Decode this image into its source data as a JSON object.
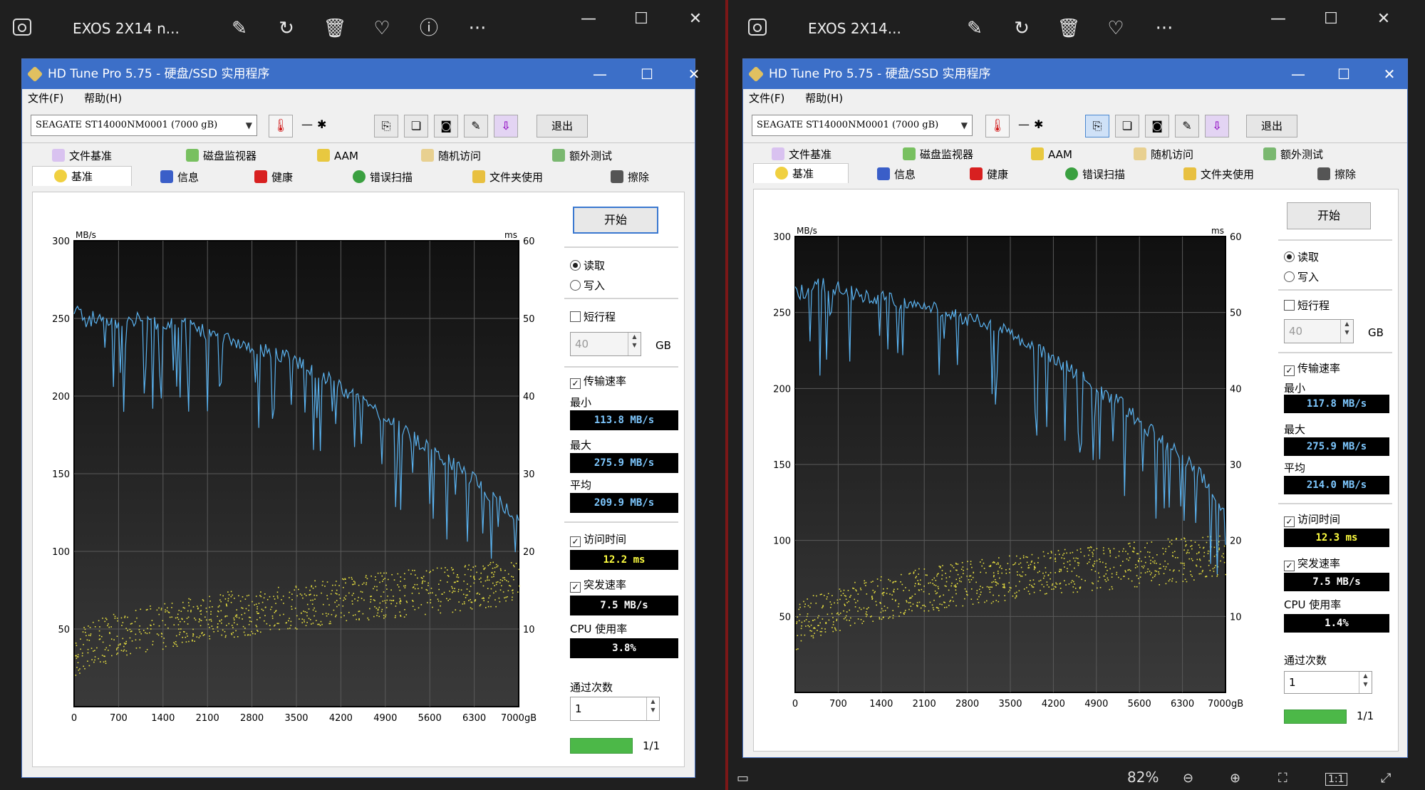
{
  "viewers": [
    {
      "title": "EXOS 2X14 n...",
      "toolbar_icons": [
        "edit-image-icon",
        "rotate-icon",
        "delete-icon",
        "favorite-icon",
        "info-icon",
        "more-icon"
      ],
      "app": {
        "title": "HD Tune Pro 5.75 - 硬盘/SSD 实用程序",
        "menu": [
          "文件(F)",
          "帮助(H)"
        ],
        "drive": "SEAGATE ST14000NM0001 (7000 gB)",
        "temp_dash": "—",
        "exit_label": "退出",
        "tabs_row1": [
          "文件基准",
          "磁盘监视器",
          "AAM",
          "随机访问",
          "额外测试"
        ],
        "tabs_row2": [
          "基准",
          "信息",
          "健康",
          "错误扫描",
          "文件夹使用",
          "擦除"
        ],
        "start_label": "开始",
        "read_label": "读取",
        "write_label": "写入",
        "short_stroke_label": "短行程",
        "short_stroke_value": "40",
        "gb_label": "GB",
        "transfer_rate_label": "传输速率",
        "min_label": "最小",
        "min_value": "113.8 MB/s",
        "max_label": "最大",
        "max_value": "275.9 MB/s",
        "avg_label": "平均",
        "avg_value": "209.9 MB/s",
        "access_time_label": "访问时间",
        "access_time_value": "12.2 ms",
        "burst_rate_label": "突发速率",
        "burst_rate_value": "7.5 MB/s",
        "cpu_label": "CPU 使用率",
        "cpu_value": "3.8%",
        "passes_label": "通过次数",
        "passes_value": "1",
        "progress_text": "1/1",
        "progress_fraction": 1.0
      }
    },
    {
      "title": "EXOS 2X14...",
      "toolbar_icons": [
        "edit-image-icon",
        "rotate-icon",
        "delete-icon",
        "favorite-icon",
        "more-icon"
      ],
      "app": {
        "title": "HD Tune Pro 5.75 - 硬盘/SSD 实用程序",
        "menu": [
          "文件(F)",
          "帮助(H)"
        ],
        "drive": "SEAGATE ST14000NM0001 (7000 gB)",
        "temp_dash": "—",
        "exit_label": "退出",
        "tabs_row1": [
          "文件基准",
          "磁盘监视器",
          "AAM",
          "随机访问",
          "额外测试"
        ],
        "tabs_row2": [
          "基准",
          "信息",
          "健康",
          "错误扫描",
          "文件夹使用",
          "擦除"
        ],
        "start_label": "开始",
        "read_label": "读取",
        "write_label": "写入",
        "short_stroke_label": "短行程",
        "short_stroke_value": "40",
        "gb_label": "GB",
        "transfer_rate_label": "传输速率",
        "min_label": "最小",
        "min_value": "117.8 MB/s",
        "max_label": "最大",
        "max_value": "275.9 MB/s",
        "avg_label": "平均",
        "avg_value": "214.0 MB/s",
        "access_time_label": "访问时间",
        "access_time_value": "12.3 ms",
        "burst_rate_label": "突发速率",
        "burst_rate_value": "7.5 MB/s",
        "cpu_label": "CPU 使用率",
        "cpu_value": "1.4%",
        "passes_label": "通过次数",
        "passes_value": "1",
        "progress_text": "1/1",
        "zoom": "82%"
      }
    }
  ],
  "chart_data": [
    {
      "type": "line",
      "xlabel": "",
      "ylabel": "MB/s",
      "y2label": "ms",
      "x_ticks": [
        "0",
        "700",
        "1400",
        "2100",
        "2800",
        "3500",
        "4200",
        "4900",
        "5600",
        "6300",
        "7000gB"
      ],
      "y_ticks": [
        "300",
        "250",
        "200",
        "150",
        "100",
        "50"
      ],
      "y2_ticks": [
        "60",
        "50",
        "40",
        "30",
        "20",
        "10"
      ],
      "xlim": [
        0,
        7000
      ],
      "ylim": [
        0,
        300
      ],
      "y2lim": [
        0,
        60
      ],
      "series": [
        {
          "values_x": [
            0,
            200,
            400,
            700,
            1000,
            1400,
            1700,
            2100,
            2500,
            2800,
            3200,
            3500,
            3900,
            4200,
            4600,
            4900,
            5300,
            5600,
            5900,
            6300,
            6600,
            7000
          ],
          "values_y": [
            255,
            248,
            252,
            246,
            250,
            244,
            248,
            240,
            236,
            232,
            228,
            222,
            214,
            205,
            196,
            185,
            175,
            165,
            158,
            146,
            135,
            120
          ]
        }
      ],
      "access_time_scatter": {
        "ms_start": 6,
        "ms_end": 16,
        "spread": 6
      },
      "colors": {
        "background": "#1c1c1c",
        "line": "#5ab2ef",
        "scatter": "#e8e040",
        "grid": "#5a5a5a"
      }
    },
    {
      "type": "line",
      "xlabel": "",
      "ylabel": "MB/s",
      "y2label": "ms",
      "x_ticks": [
        "0",
        "700",
        "1400",
        "2100",
        "2800",
        "3500",
        "4200",
        "4900",
        "5600",
        "6300",
        "7000gB"
      ],
      "y_ticks": [
        "300",
        "250",
        "200",
        "150",
        "100",
        "50"
      ],
      "y2_ticks": [
        "60",
        "50",
        "40",
        "30",
        "20",
        "10"
      ],
      "xlim": [
        0,
        7000
      ],
      "ylim": [
        0,
        300
      ],
      "y2lim": [
        0,
        60
      ],
      "series": [
        {
          "values_x": [
            0,
            200,
            400,
            700,
            1000,
            1400,
            1700,
            2100,
            2500,
            2800,
            3200,
            3500,
            3900,
            4200,
            4600,
            4900,
            5300,
            5600,
            5900,
            6300,
            6600,
            7000
          ],
          "values_y": [
            262,
            265,
            268,
            266,
            262,
            260,
            256,
            254,
            250,
            246,
            242,
            236,
            228,
            220,
            210,
            200,
            190,
            178,
            168,
            155,
            142,
            120
          ]
        }
      ],
      "access_time_scatter": {
        "ms_start": 8,
        "ms_end": 18,
        "spread": 6
      },
      "colors": {
        "background": "#1c1c1c",
        "line": "#5ab2ef",
        "scatter": "#e8e040",
        "grid": "#5a5a5a"
      }
    }
  ]
}
